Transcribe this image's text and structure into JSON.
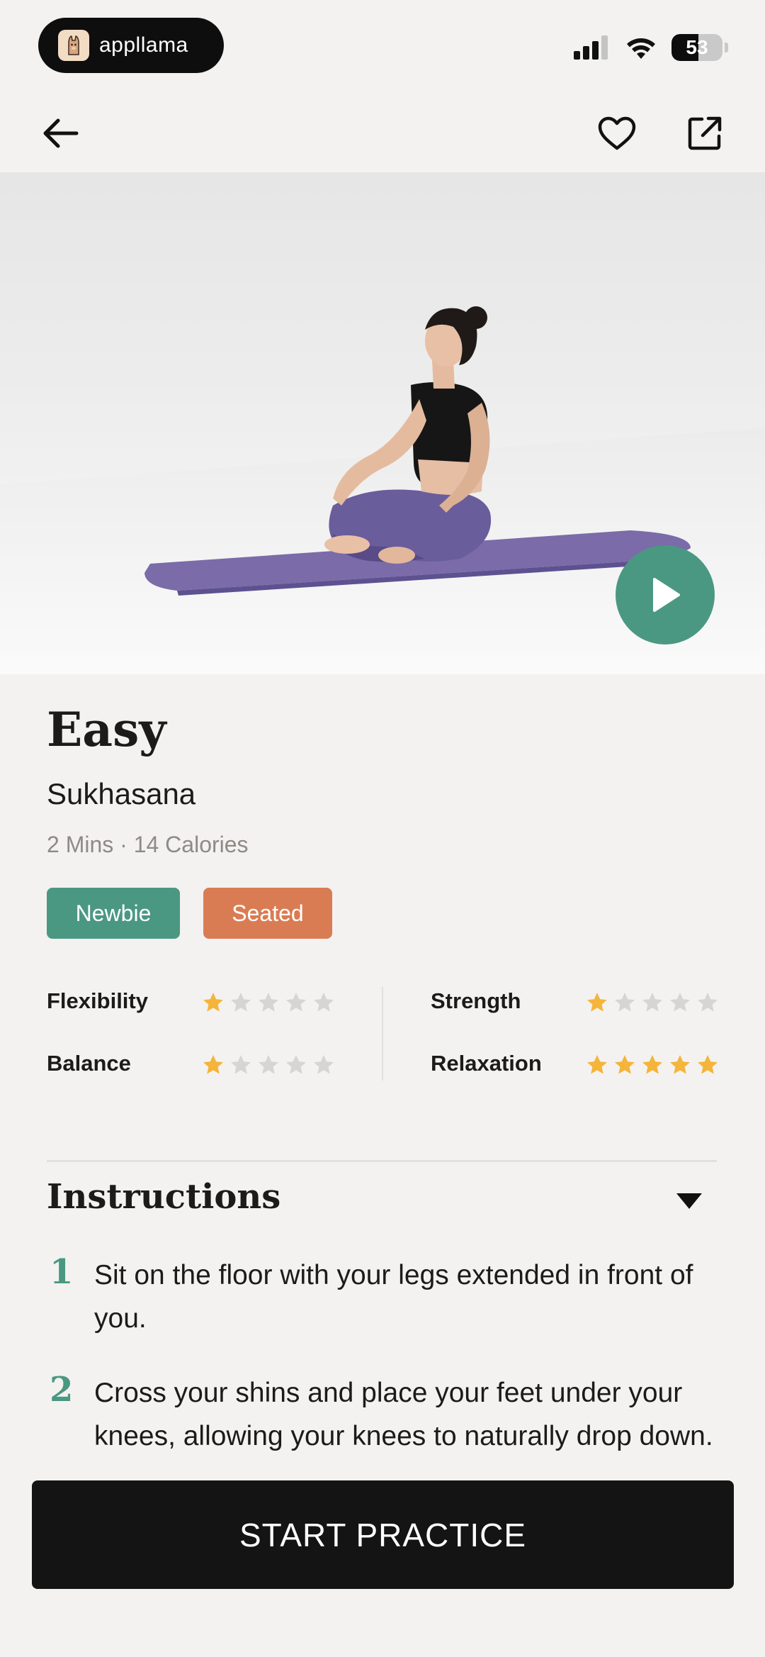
{
  "status_bar": {
    "app_name": "appllama",
    "battery": "53",
    "battery_level": 0.53
  },
  "nav": {
    "back_icon": "arrow-left-icon",
    "favorite_icon": "heart-outline-icon",
    "share_icon": "external-link-icon"
  },
  "hero": {
    "description_icon": "play-icon"
  },
  "pose": {
    "level": "Easy",
    "name": "Sukhasana",
    "meta": "2 Mins · 14 Calories",
    "tags": [
      {
        "label": "Newbie",
        "color": "#4a9882"
      },
      {
        "label": "Seated",
        "color": "#da7c53"
      }
    ]
  },
  "ratings": [
    {
      "label": "Flexibility",
      "value": 1,
      "max": 5
    },
    {
      "label": "Strength",
      "value": 1,
      "max": 5
    },
    {
      "label": "Balance",
      "value": 1,
      "max": 5
    },
    {
      "label": "Relaxation",
      "value": 5,
      "max": 5
    }
  ],
  "instructions": {
    "title": "Instructions",
    "steps": [
      {
        "number": "1",
        "text": "Sit on the floor with your legs extended in front of you."
      },
      {
        "number": "2",
        "text": "Cross your shins and place your feet under your knees, allowing your knees to naturally drop down."
      }
    ]
  },
  "cta": {
    "label": "START PRACTICE"
  },
  "colors": {
    "accent_green": "#4a9882",
    "accent_orange": "#da7c53",
    "star_filled": "#f5b43a",
    "star_empty": "#d7d5d2",
    "background": "#f3f2f0"
  }
}
